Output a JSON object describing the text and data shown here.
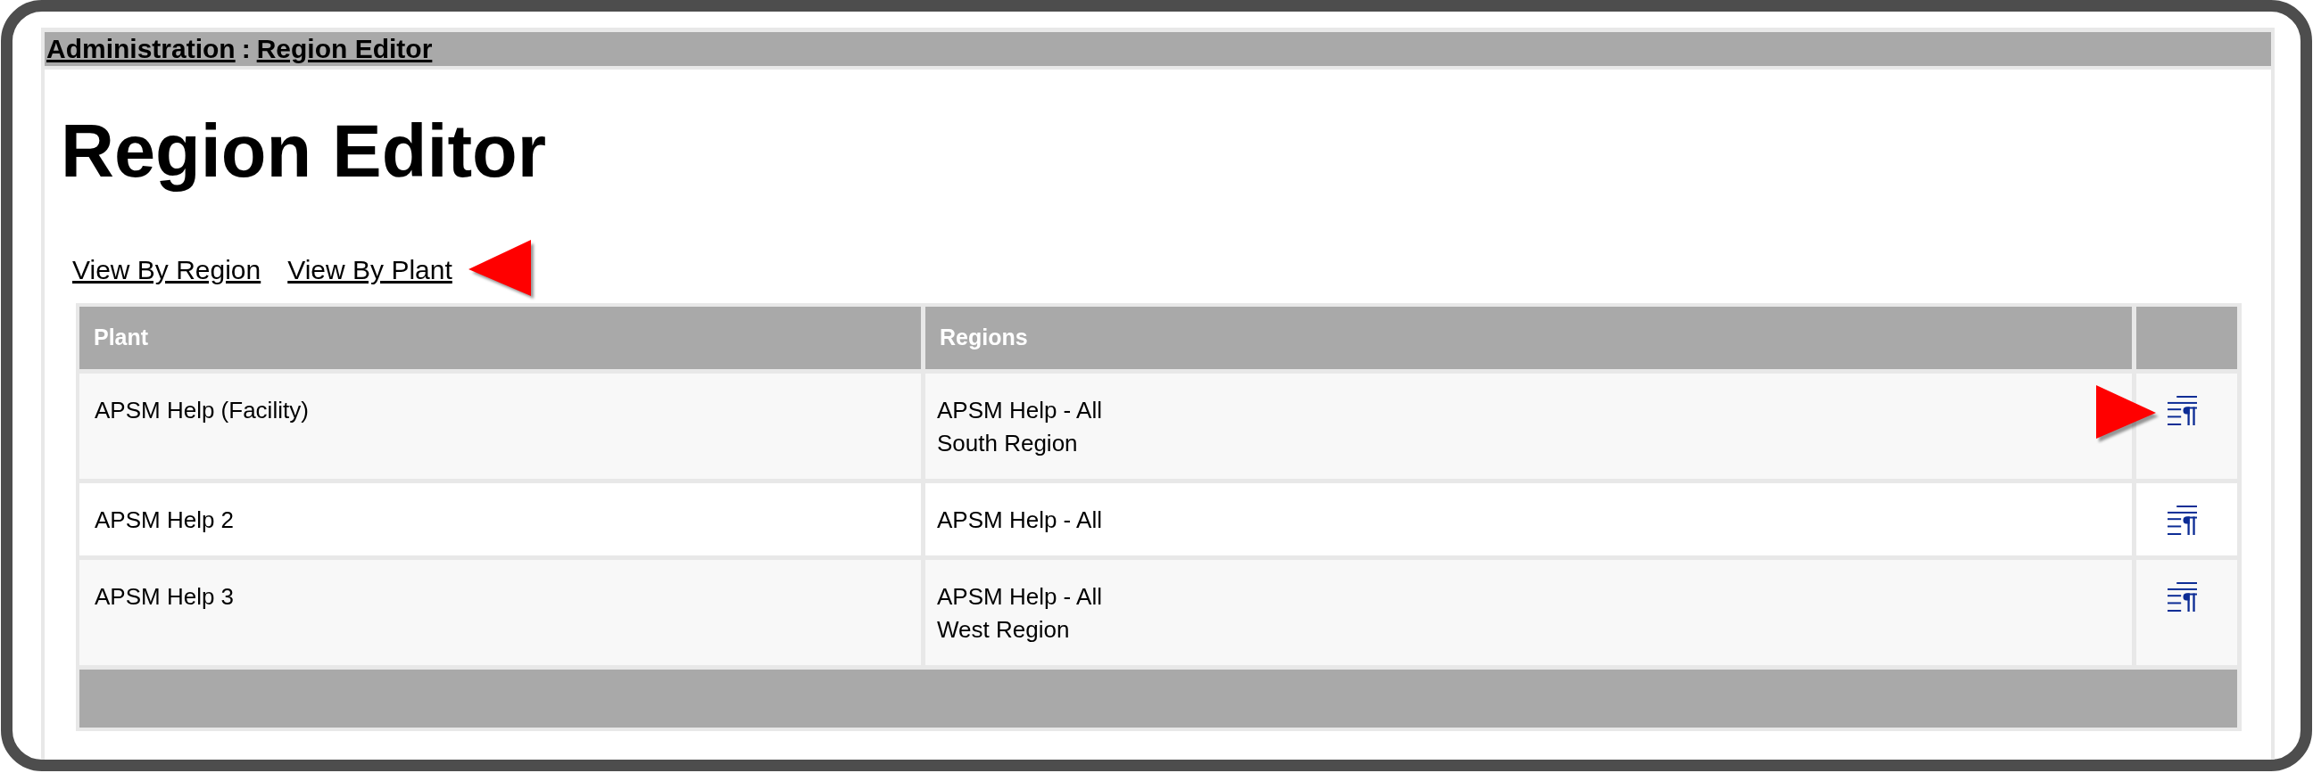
{
  "breadcrumb": {
    "items": [
      "Administration",
      "Region Editor"
    ],
    "separator": ":"
  },
  "title": "Region Editor",
  "view_links": [
    {
      "label": "View By Region",
      "callout": false
    },
    {
      "label": "View By Plant",
      "callout": true
    }
  ],
  "table": {
    "columns": [
      "Plant",
      "Regions"
    ],
    "rows": [
      {
        "plant": "APSM Help (Facility)",
        "regions": [
          "APSM Help - All",
          "South Region"
        ],
        "callout": true
      },
      {
        "plant": "APSM Help 2",
        "regions": [
          "APSM Help - All"
        ],
        "callout": false
      },
      {
        "plant": "APSM Help 3",
        "regions": [
          "APSM Help - All",
          "West Region"
        ],
        "callout": false
      }
    ]
  }
}
